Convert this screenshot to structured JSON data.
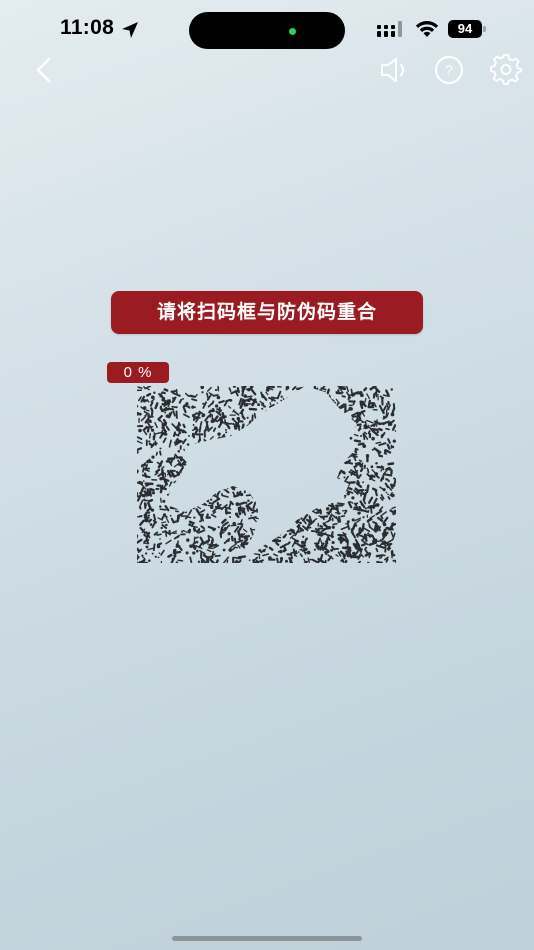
{
  "status_bar": {
    "time": "11:08",
    "battery": "94",
    "icons": [
      "location-arrow-icon",
      "cellular-signal-icon",
      "wifi-icon",
      "battery-icon"
    ],
    "camera_indicator_color": "#2fd158"
  },
  "toolbar": {
    "back_icon": "chevron-left-icon",
    "sound_icon": "speaker-icon",
    "help_icon": "question-circle-icon",
    "help_label": "?",
    "settings_icon": "gear-icon"
  },
  "scanner": {
    "instruction": "请将扫码框与防伪码重合",
    "progress_label": "0 %",
    "progress": 0
  },
  "colors": {
    "accent": "#9a1c22",
    "background_top": "#e4ecf0",
    "background_bottom": "#bfd0da",
    "icon_color": "#ffffff"
  }
}
